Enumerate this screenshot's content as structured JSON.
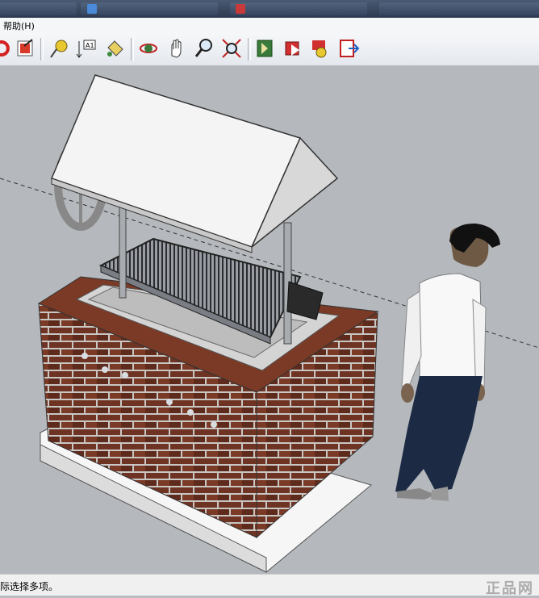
{
  "menu": {
    "help_label": "帮助(H)"
  },
  "toolbar": {
    "buttons": [
      {
        "name": "redo-icon"
      },
      {
        "name": "export-icon"
      },
      {
        "name": "tape-measure-icon"
      },
      {
        "name": "dimension-icon"
      },
      {
        "name": "paint-bucket-icon"
      },
      {
        "name": "orbit-icon"
      },
      {
        "name": "pan-icon"
      },
      {
        "name": "zoom-icon"
      },
      {
        "name": "zoom-extents-icon"
      },
      {
        "name": "get-models-icon"
      },
      {
        "name": "share-model-icon"
      },
      {
        "name": "share-component-icon"
      },
      {
        "name": "send-to-layout-icon"
      }
    ]
  },
  "status": {
    "text": "际选择多项。"
  },
  "watermark": {
    "text": "正品网"
  },
  "colors": {
    "sky": "#b5b9bd",
    "brick": "#6b2f1f",
    "mortar": "#c8c8c8",
    "roof": "#f2f2f2"
  }
}
